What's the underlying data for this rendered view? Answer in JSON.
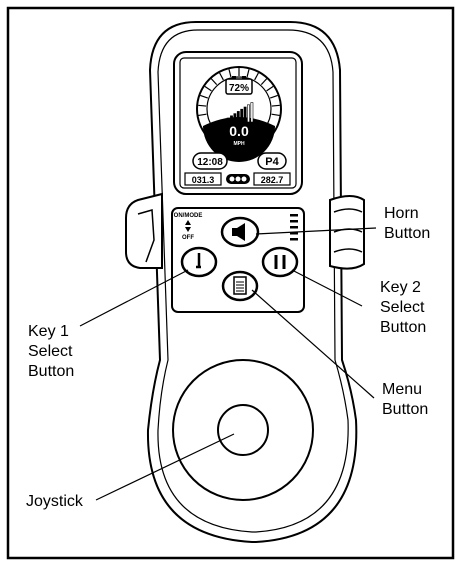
{
  "display": {
    "battery_percent": "72%",
    "battery_level": 0.72,
    "speed": "0.0",
    "speed_unit": "MPH",
    "time": "12:08",
    "profile": "P4",
    "trip": "031.3",
    "odometer": "282.7"
  },
  "keypad": {
    "onmode_label": "ON/MODE",
    "off_label": "OFF"
  },
  "labels": {
    "horn": [
      "Horn",
      "Button"
    ],
    "key2": [
      "Key 2",
      "Select",
      "Button"
    ],
    "key1": [
      "Key 1",
      "Select",
      "Button"
    ],
    "menu": [
      "Menu",
      "Button"
    ],
    "joystick": "Joystick"
  },
  "colors": {
    "line": "#000000",
    "background": "#ffffff",
    "screen_dark": "#000000"
  }
}
